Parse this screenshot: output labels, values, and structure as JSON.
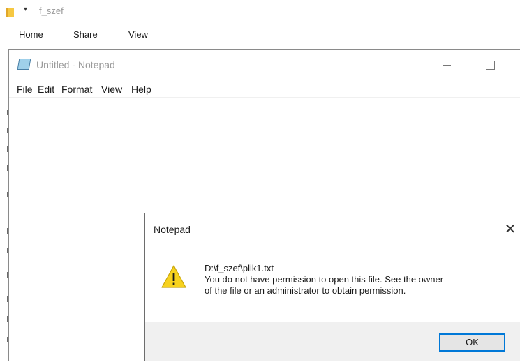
{
  "explorer": {
    "title": "f_szef",
    "quick_access_arrow": "▾",
    "ribbon_tabs": [
      {
        "label": "Home"
      },
      {
        "label": "Share"
      },
      {
        "label": "View"
      }
    ]
  },
  "notepad": {
    "title": "Untitled - Notepad",
    "menu": [
      {
        "label": "File"
      },
      {
        "label": "Edit"
      },
      {
        "label": "Format"
      },
      {
        "label": "View"
      },
      {
        "label": "Help"
      }
    ],
    "editor_text": ""
  },
  "dialog": {
    "title": "Notepad",
    "close_glyph": "✕",
    "icon": "warning-icon",
    "path": "D:\\f_szef\\plik1.txt",
    "message": "You do not have permission to open this file.  See the owner\nof the file or an administrator to obtain permission.",
    "ok_label": "OK"
  },
  "colors": {
    "accent": "#0078d7",
    "warning": "#f7d21e",
    "folder": "#f6c842"
  }
}
